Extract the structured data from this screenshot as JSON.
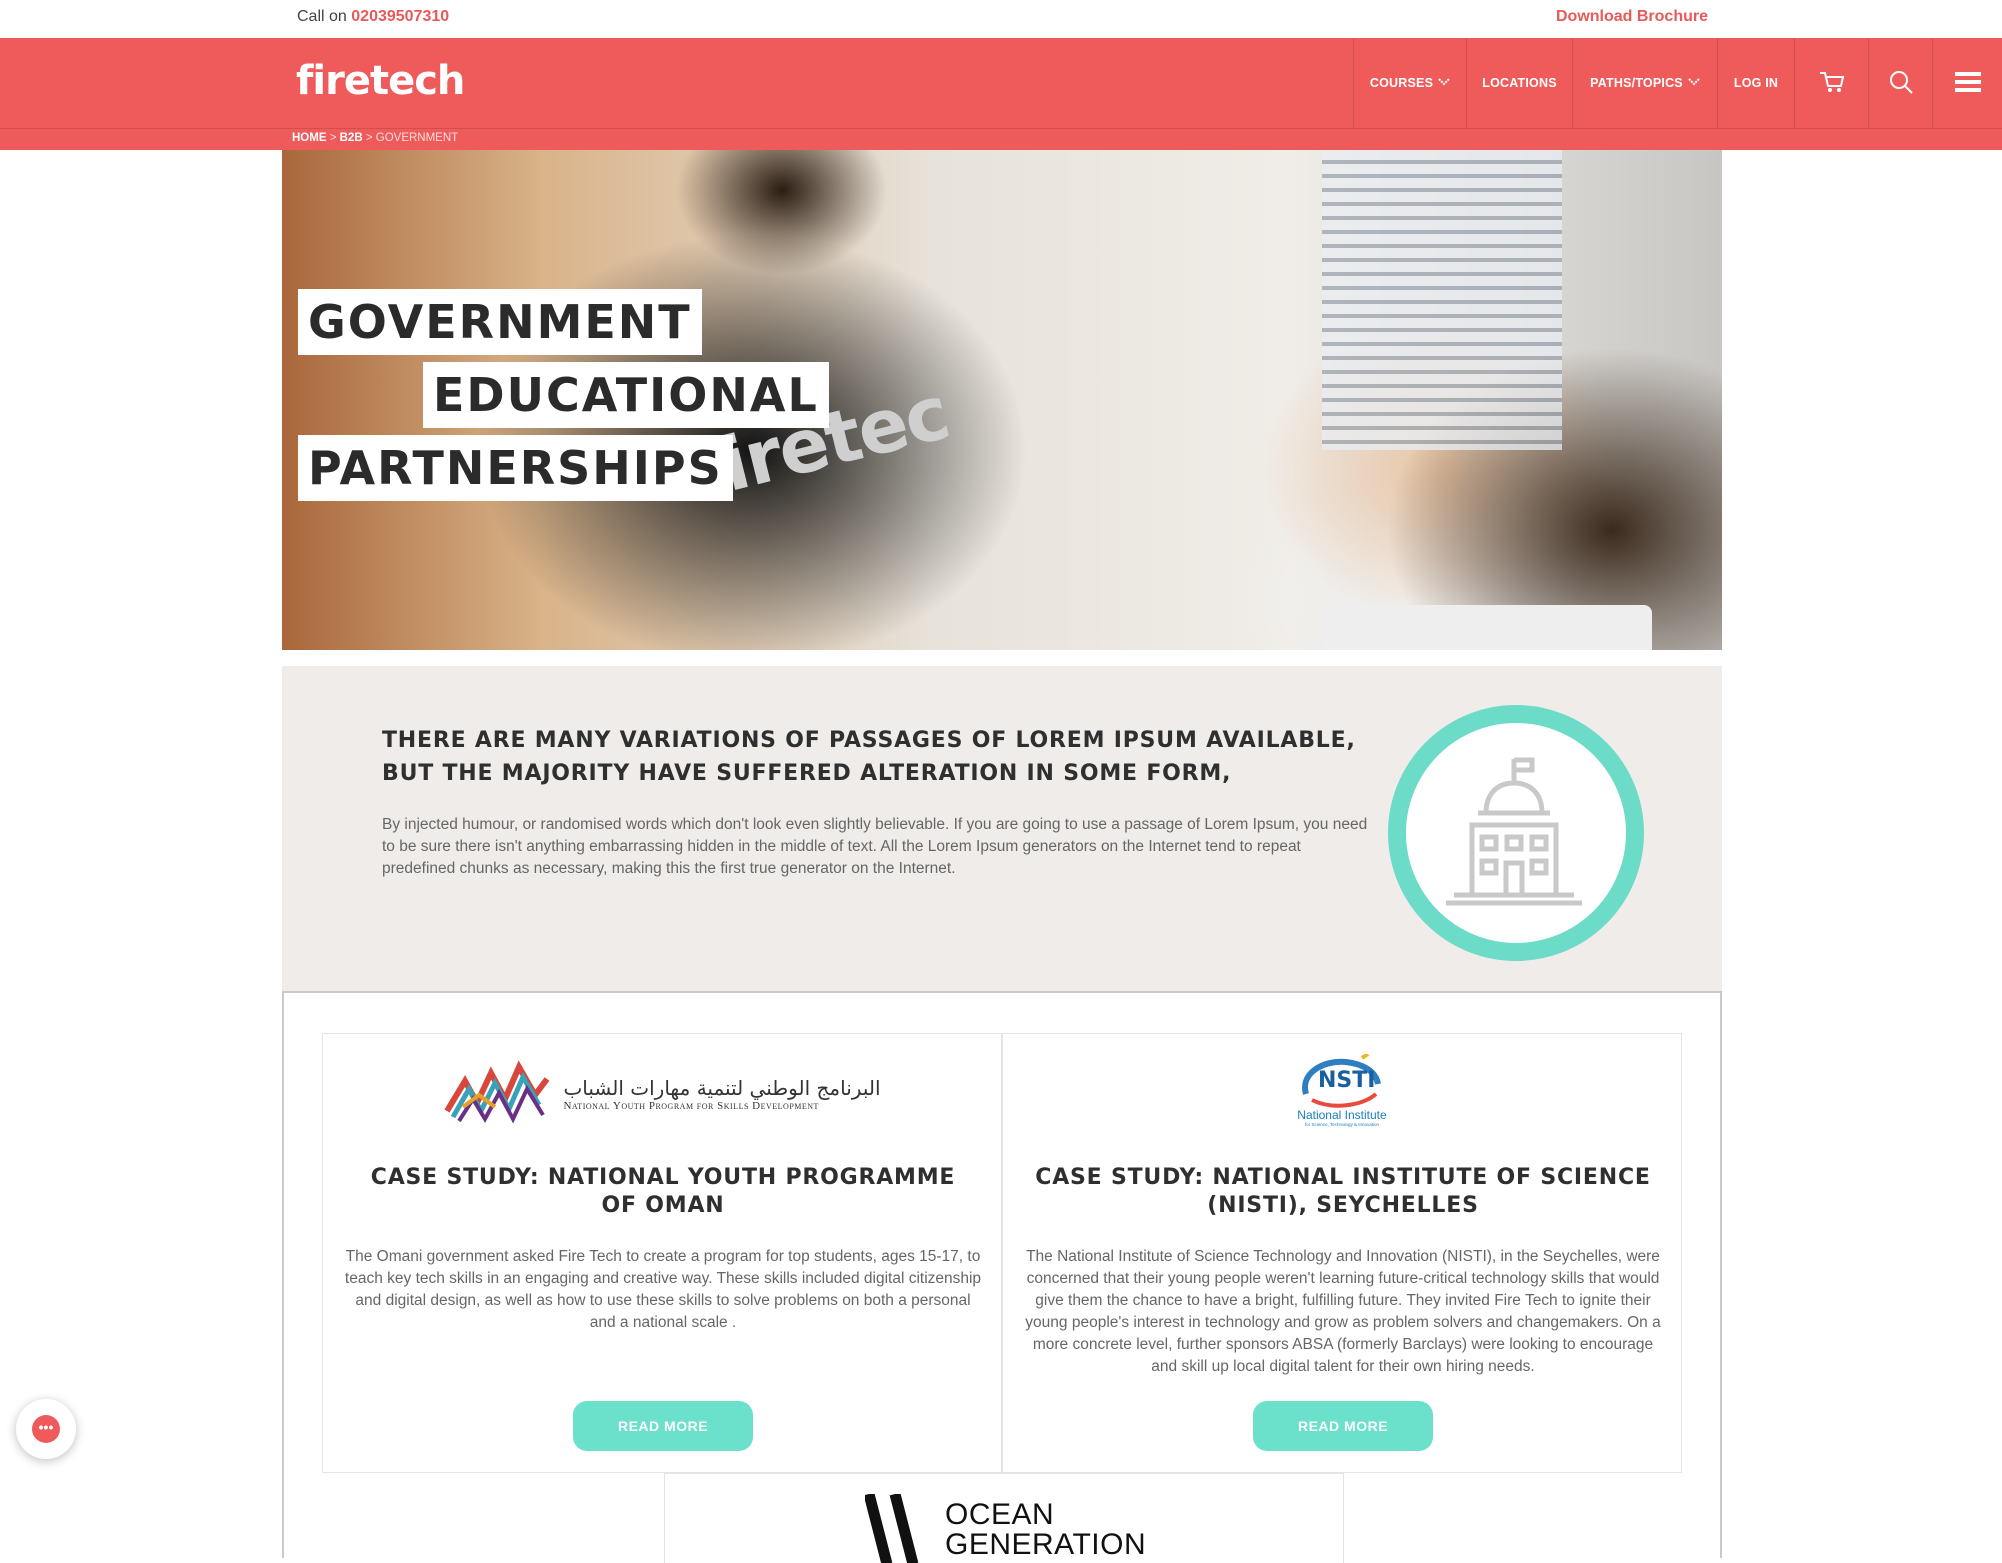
{
  "topbar": {
    "call_label": "Call on",
    "phone": "02039507310",
    "brochure": "Download Brochure"
  },
  "nav": {
    "logo": "firetech",
    "items": [
      {
        "label": "COURSES",
        "has_dropdown": true
      },
      {
        "label": "LOCATIONS",
        "has_dropdown": false
      },
      {
        "label": "PATHS/TOPICS",
        "has_dropdown": true
      },
      {
        "label": "LOG IN",
        "has_dropdown": false
      }
    ],
    "icons": [
      "cart-icon",
      "search-icon",
      "menu-icon"
    ]
  },
  "breadcrumb": {
    "home": "HOME",
    "sep1": ">",
    "b2b": "B2B",
    "sep2": ">",
    "current": "GOVERNMENT"
  },
  "hero": {
    "line1": "GOVERNMENT",
    "line2": "EDUCATIONAL",
    "line3": "PARTNERSHIPS",
    "shirt_text": "firetec"
  },
  "intro": {
    "heading": "THERE ARE MANY VARIATIONS OF PASSAGES OF LOREM IPSUM AVAILABLE, BUT THE MAJORITY HAVE SUFFERED ALTERATION IN SOME FORM,",
    "body": "By injected humour, or randomised words which don't look even slightly believable. If you are going to use a passage of Lorem Ipsum, you need to be sure there isn't anything embarrassing hidden in the middle of text. All the Lorem Ipsum generators on the Internet tend to repeat predefined chunks as necessary, making this the first true generator on the Internet.",
    "badge_icon": "government-building-icon"
  },
  "cases": [
    {
      "logo_ar": "البرنامج الوطني لتنمية مهارات الشباب",
      "logo_en": "National Youth Program for Skills Development",
      "title": "CASE STUDY: NATIONAL YOUTH PROGRAMME OF OMAN",
      "body": "The Omani government asked Fire Tech to create a program for top students, ages 15-17, to teach key tech skills in an engaging and creative way. These skills included digital citizenship and digital design, as well as how to use these skills to solve problems on both a personal and a national scale .",
      "button": "READ MORE"
    },
    {
      "logo_short": "NSTI",
      "logo_name": "National Institute",
      "logo_sub": "for Science, Technology & Innovation",
      "title": "CASE STUDY: NATIONAL INSTITUTE OF SCIENCE (NISTI), SEYCHELLES",
      "body": "The National Institute of Science Technology and Innovation (NISTI), in the Seychelles, were concerned that their young people weren't learning future-critical technology skills that would give them the chance to have a bright, fulfilling future. They invited Fire Tech to ignite their young people's interest in technology and grow as problem solvers and changemakers. On a more concrete level, further sponsors ABSA (formerly Barclays) were looking to encourage and skill up local digital talent for their own hiring needs.",
      "button": "READ MORE"
    }
  ],
  "third_case": {
    "logo_line1": "OCEAN",
    "logo_line2": "GENERATION"
  },
  "colors": {
    "brand_red": "#ef5b5b",
    "accent_teal": "#6be0cb",
    "panel_bg": "#efece9"
  }
}
